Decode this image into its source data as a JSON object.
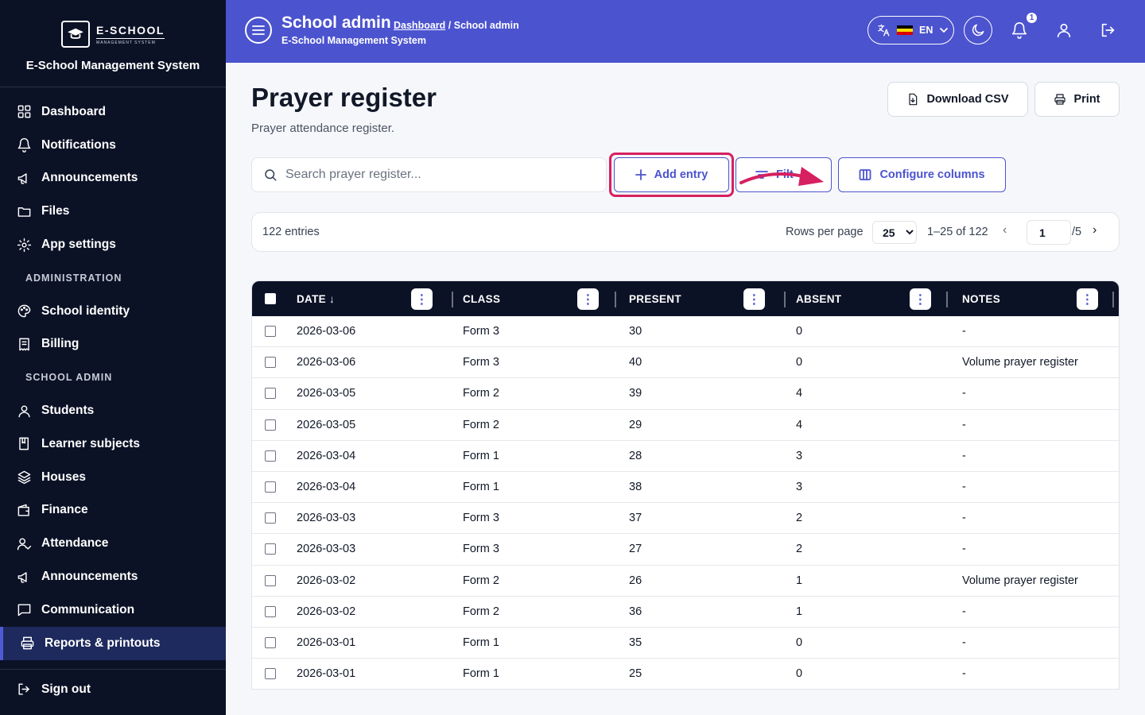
{
  "sidebar": {
    "logo_text": "E-SCHOOL",
    "logo_subtext": "MANAGEMENT SYSTEM",
    "system_name": "E-School Management System",
    "items_top": [
      {
        "label": "Dashboard",
        "icon": "grid-icon"
      },
      {
        "label": "Notifications",
        "icon": "bell-icon"
      },
      {
        "label": "Announcements",
        "icon": "megaphone-icon"
      },
      {
        "label": "Files",
        "icon": "folder-icon"
      },
      {
        "label": "App settings",
        "icon": "gear-icon"
      }
    ],
    "section_admin": "ADMINISTRATION",
    "items_admin": [
      {
        "label": "School identity",
        "icon": "palette-icon"
      },
      {
        "label": "Billing",
        "icon": "receipt-icon"
      }
    ],
    "section_school": "SCHOOL ADMIN",
    "items_school": [
      {
        "label": "Students",
        "icon": "user-icon"
      },
      {
        "label": "Learner subjects",
        "icon": "book-icon"
      },
      {
        "label": "Houses",
        "icon": "layers-icon"
      },
      {
        "label": "Finance",
        "icon": "wallet-icon"
      },
      {
        "label": "Attendance",
        "icon": "user-check-icon"
      },
      {
        "label": "Announcements",
        "icon": "megaphone-icon"
      },
      {
        "label": "Communication",
        "icon": "message-icon"
      },
      {
        "label": "Reports & printouts",
        "icon": "printer-icon",
        "active": true
      }
    ],
    "sign_out": "Sign out"
  },
  "header": {
    "title": "School admin",
    "breadcrumb_link": "Dashboard",
    "breadcrumb_sep": "/",
    "breadcrumb_current": "School admin",
    "subtitle": "E-School Management System",
    "language": "EN",
    "notification_count": "1",
    "accent_color": "#4b53cf"
  },
  "main": {
    "title": "Prayer register",
    "subtitle": "Prayer attendance register.",
    "download_csv": "Download CSV",
    "print": "Print",
    "search_placeholder": "Search prayer register...",
    "add_entry": "Add entry",
    "filter": "Filter",
    "filter_visible": "Filt",
    "configure_columns": "Configure columns"
  },
  "pagination": {
    "entries": "122 entries",
    "rows_per_page_label": "Rows per page",
    "rows_per_page": "25",
    "range": "1–25 of 122",
    "page": "1",
    "total_pages": "/5"
  },
  "table": {
    "columns": [
      "DATE",
      "CLASS",
      "PRESENT",
      "ABSENT",
      "NOTES"
    ],
    "sort_indicator": "↓",
    "rows": [
      [
        "2026-03-06",
        "Form 3",
        "30",
        "0",
        "-"
      ],
      [
        "2026-03-06",
        "Form 3",
        "40",
        "0",
        "Volume prayer register"
      ],
      [
        "2026-03-05",
        "Form 2",
        "39",
        "4",
        "-"
      ],
      [
        "2026-03-05",
        "Form 2",
        "29",
        "4",
        "-"
      ],
      [
        "2026-03-04",
        "Form 1",
        "28",
        "3",
        "-"
      ],
      [
        "2026-03-04",
        "Form 1",
        "38",
        "3",
        "-"
      ],
      [
        "2026-03-03",
        "Form 3",
        "37",
        "2",
        "-"
      ],
      [
        "2026-03-03",
        "Form 3",
        "27",
        "2",
        "-"
      ],
      [
        "2026-03-02",
        "Form 2",
        "26",
        "1",
        "Volume prayer register"
      ],
      [
        "2026-03-02",
        "Form 2",
        "36",
        "1",
        "-"
      ],
      [
        "2026-03-01",
        "Form 1",
        "35",
        "0",
        "-"
      ],
      [
        "2026-03-01",
        "Form 1",
        "25",
        "0",
        "-"
      ]
    ]
  },
  "annotation": {
    "highlight_color": "#d62060"
  }
}
